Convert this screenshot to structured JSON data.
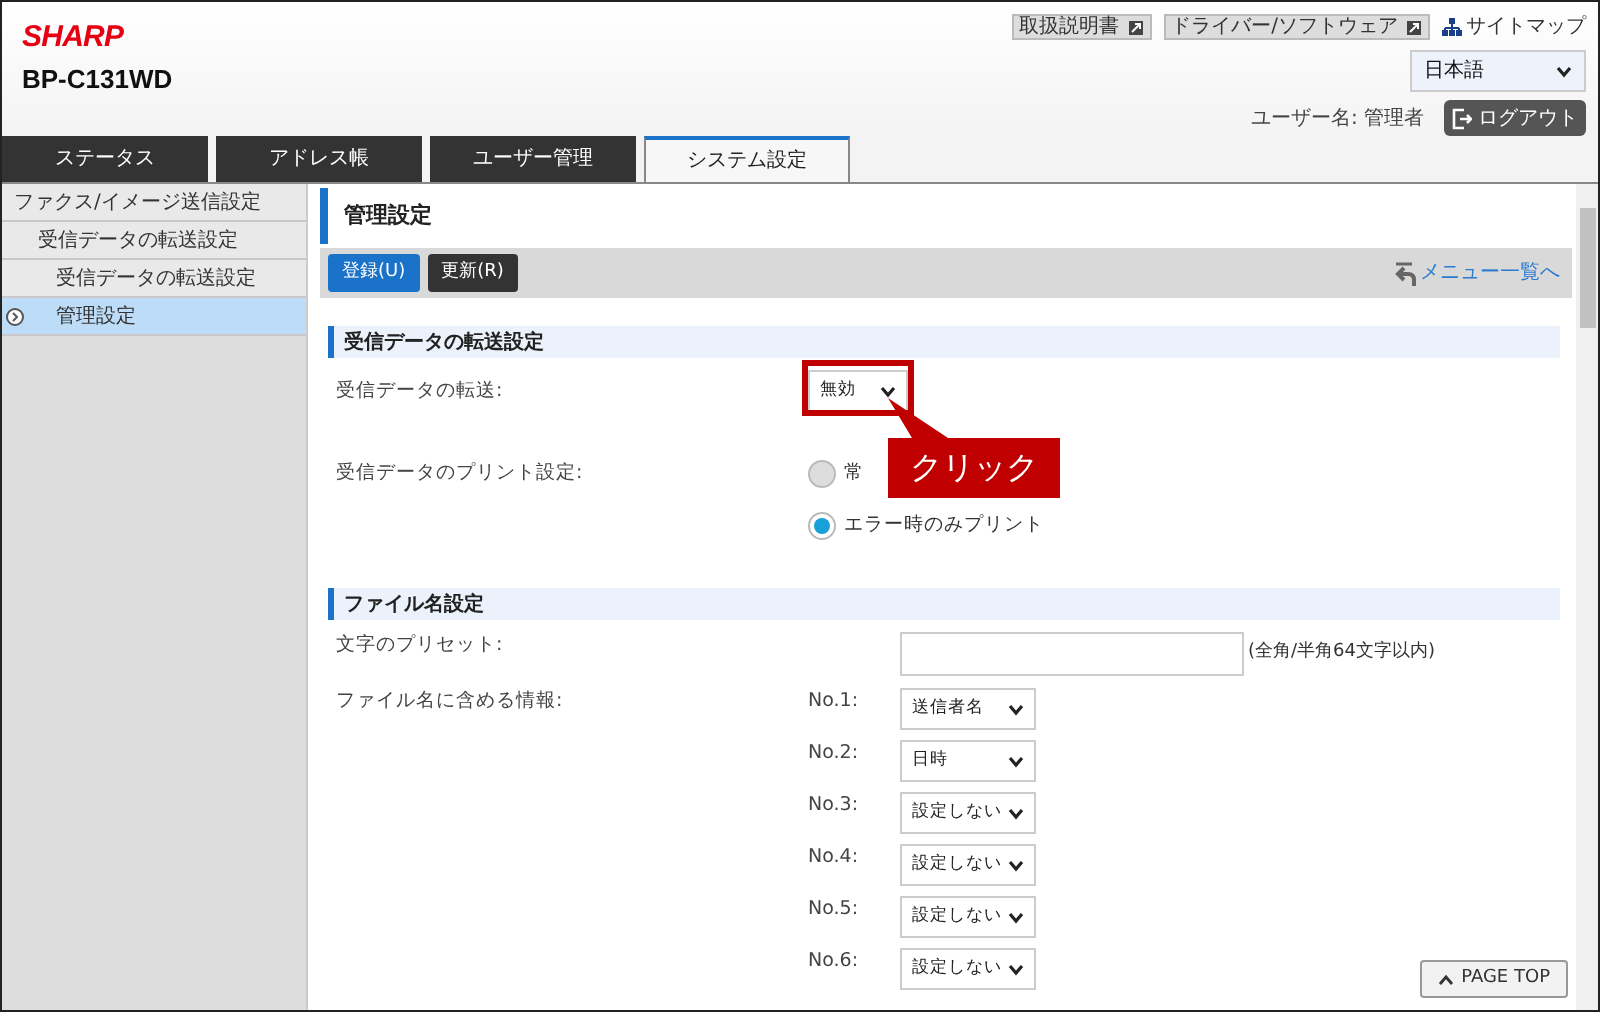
{
  "header": {
    "logo": "SHARP",
    "model": "BP-C131WD",
    "links": [
      {
        "label": "取扱説明書"
      },
      {
        "label": "ドライバー/ソフトウェア"
      }
    ],
    "sitemap": "サイトマップ",
    "language": "日本語",
    "user": "ユーザー名: 管理者",
    "logout": "ログアウト"
  },
  "tabs": [
    {
      "label": "ステータス",
      "selected": false
    },
    {
      "label": "アドレス帳",
      "selected": false
    },
    {
      "label": "ユーザー管理",
      "selected": false
    },
    {
      "label": "システム設定",
      "selected": true
    }
  ],
  "sidebar": {
    "items": [
      {
        "label": "ファクス/イメージ送信設定",
        "selected": false,
        "children": [
          {
            "label": "受信データの転送設定",
            "selected": false,
            "children": [
              {
                "label": "受信データの転送設定",
                "selected": false
              },
              {
                "label": "管理設定",
                "selected": true
              }
            ]
          }
        ]
      }
    ]
  },
  "page_title": "管理設定",
  "toolbar": {
    "buttons": [
      {
        "label": "登録(U)",
        "kind": "primary"
      },
      {
        "label": "更新(R)",
        "kind": "secondary"
      }
    ],
    "menu_link": "メニュー一覧へ"
  },
  "sections": [
    {
      "title": "受信データの転送設定",
      "rows": [
        {
          "kind": "select",
          "label": "受信データの転送:",
          "value": "無効",
          "highlighted": true
        },
        {
          "kind": "radio",
          "label": "受信データのプリント設定:",
          "options": [
            {
              "label": "常",
              "selected": false
            },
            {
              "label": "エラー時のみプリント",
              "selected": true
            }
          ]
        }
      ]
    },
    {
      "title": "ファイル名設定",
      "rows": [
        {
          "kind": "text",
          "label": "文字のプリセット:",
          "value": "",
          "note": "(全角/半角64文字以内)"
        },
        {
          "kind": "selects",
          "label": "ファイル名に含める情報:",
          "items": [
            {
              "no": "No.1:",
              "value": "送信者名"
            },
            {
              "no": "No.2:",
              "value": "日時"
            },
            {
              "no": "No.3:",
              "value": "設定しない"
            },
            {
              "no": "No.4:",
              "value": "設定しない"
            },
            {
              "no": "No.5:",
              "value": "設定しない"
            },
            {
              "no": "No.6:",
              "value": "設定しない"
            }
          ]
        }
      ]
    }
  ],
  "callout": "クリック",
  "page_top": "PAGE TOP"
}
